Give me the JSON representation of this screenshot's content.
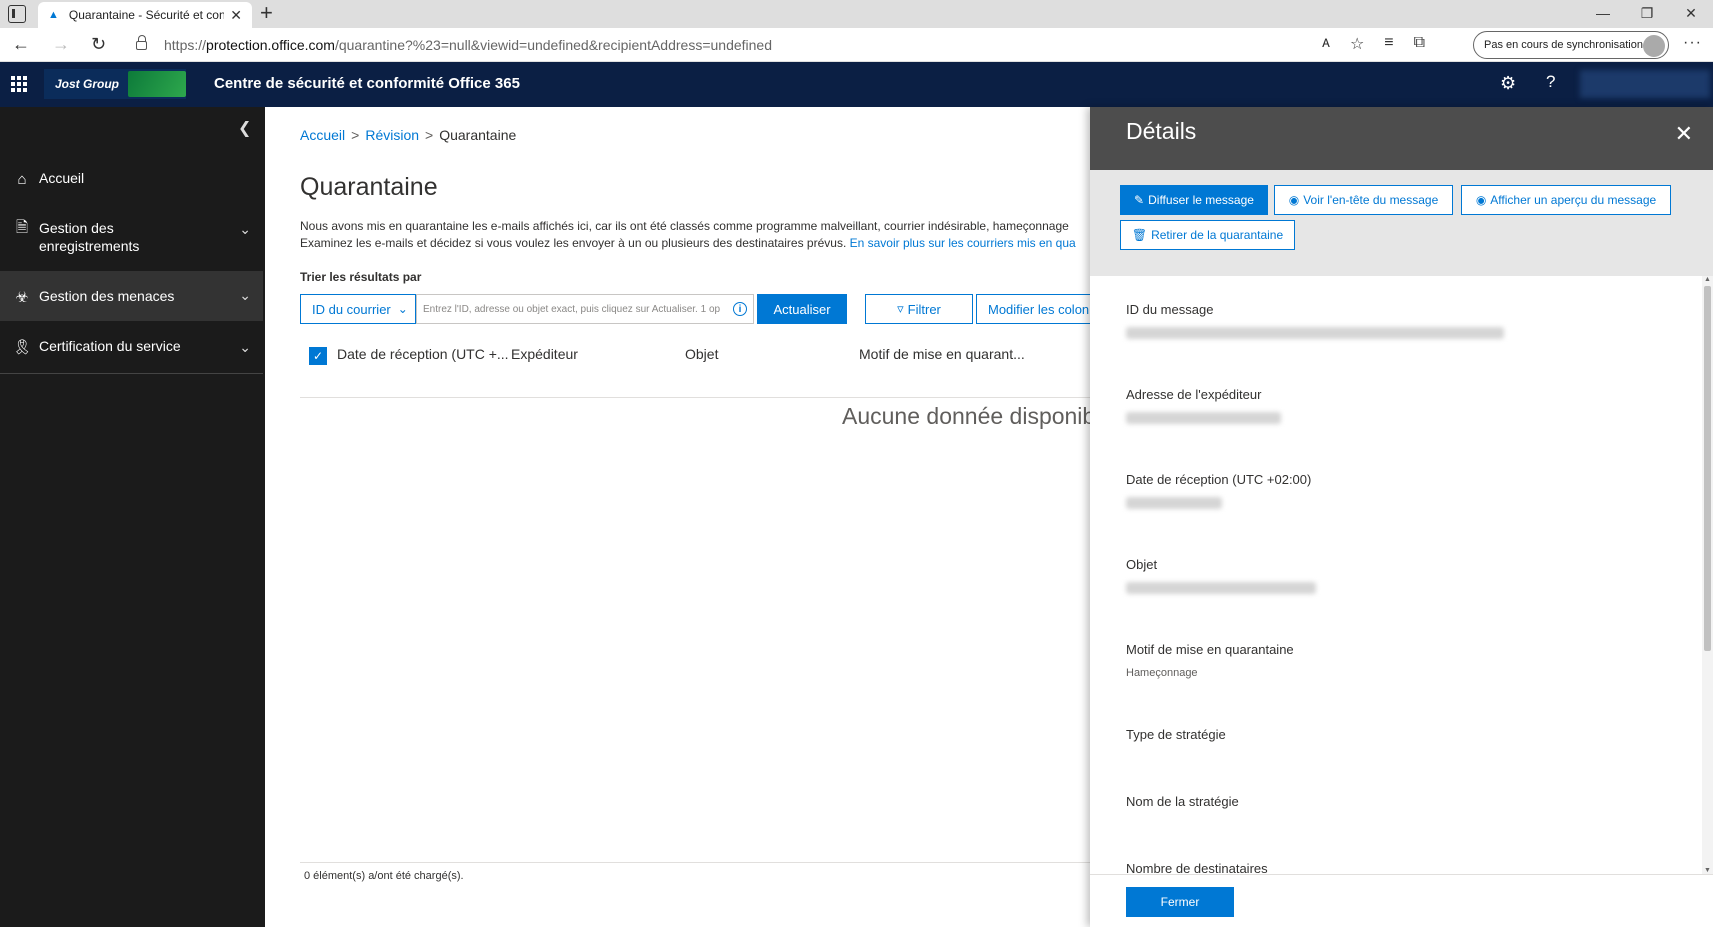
{
  "browser": {
    "tab_title": "Quarantaine - Sécurité et confor",
    "url_scheme": "https://",
    "url_host": "protection.office.com",
    "url_path": "/quarantine?%23=null&viewid=undefined&recipientAddress=undefined",
    "sync_label": "Pas en cours de synchronisation"
  },
  "header": {
    "logo_text": "Jost Group",
    "app_title": "Centre de sécurité et conformité Office 365"
  },
  "sidebar": {
    "items": [
      {
        "label": "Accueil",
        "icon": "home-icon"
      },
      {
        "label": "Gestion des enregistrements",
        "icon": "records-icon"
      },
      {
        "label": "Gestion des menaces",
        "icon": "biohazard-icon"
      },
      {
        "label": "Certification du service",
        "icon": "ribbon-icon"
      }
    ]
  },
  "main": {
    "breadcrumb": {
      "home": "Accueil",
      "sep": ">",
      "review": "Révision",
      "current": "Quarantaine"
    },
    "title": "Quarantaine",
    "desc_line1": "Nous avons mis en quarantaine les e-mails affichés ici, car ils ont été classés comme programme malveillant, courrier indésirable, hameçonnage",
    "desc_line2": "Examinez les e-mails et décidez si vous voulez les envoyer à un ou plusieurs des destinataires prévus. ",
    "learn_more": "En savoir plus sur les courriers mis en qua",
    "sort_label": "Trier les résultats par",
    "sort_value": "ID du courrier",
    "search_placeholder": "Entrez l'ID, adresse ou objet exact, puis cliquez sur Actualiser. 1 op",
    "refresh": "Actualiser",
    "filter": "Filtrer",
    "modify_columns": "Modifier les colonnes",
    "columns": [
      "Date de réception (UTC +...",
      "Expéditeur",
      "Objet",
      "Motif de mise en quarant..."
    ],
    "empty": "Aucune donnée disponible",
    "status": "0 élément(s) a/ont été chargé(s)."
  },
  "panel": {
    "title": "Détails",
    "actions": {
      "release": "Diffuser le message",
      "view_header": "Voir l'en-tête du message",
      "preview": "Afficher un aperçu du message",
      "remove": "Retirer de la quarantaine"
    },
    "fields": {
      "message_id": "ID du message",
      "sender": "Adresse de l'expéditeur",
      "received": "Date de réception (UTC +02:00)",
      "subject": "Objet",
      "reason": "Motif de mise en quarantaine",
      "reason_value": "Hameçonnage",
      "policy_type": "Type de stratégie",
      "policy_name": "Nom de la stratégie",
      "recipients": "Nombre de destinataires"
    },
    "close": "Fermer"
  },
  "colors": {
    "accent": "#0078d4",
    "header_bg": "#0b1f44",
    "sidebar_bg": "#1b1b1b",
    "panel_head": "#4d4d4d"
  }
}
